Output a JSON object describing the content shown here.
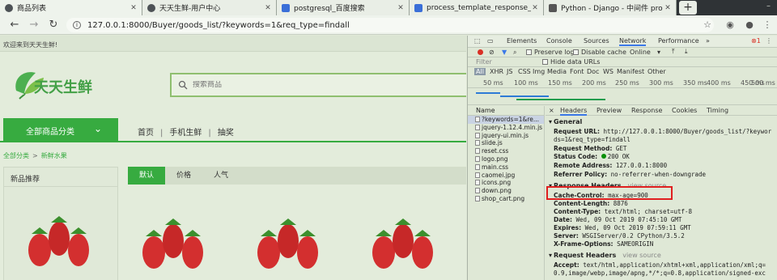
{
  "browser": {
    "tabs": [
      {
        "title": "商品列表",
        "active": true
      },
      {
        "title": "天天生鲜-用户中心",
        "active": false
      },
      {
        "title": "postgresql_百度搜索",
        "active": false
      },
      {
        "title": "process_template_response_",
        "active": false
      },
      {
        "title": "Python - Django - 中间件 pro",
        "active": false
      }
    ],
    "new_tab": "+",
    "address": "127.0.0.1:8000/Buyer/goods_list/?keywords=1&req_type=findall",
    "info_icon": "i"
  },
  "site": {
    "welcome": "欢迎来到天天生鲜!",
    "logo_text": "天天生鲜",
    "search_placeholder": "搜索商品",
    "all_categories": "全部商品分类",
    "nav": [
      "首页",
      "手机生鲜",
      "抽奖"
    ],
    "breadcrumb": [
      "全部分类",
      "新鲜水果"
    ],
    "new_products": "新品推荐",
    "sort": [
      "默认",
      "价格",
      "人气"
    ],
    "accent_color": "#37ab40"
  },
  "devtools": {
    "tabs": [
      "Elements",
      "Console",
      "Sources",
      "Network",
      "Performance",
      "»"
    ],
    "error_count": "1",
    "toolbar": {
      "preserve_log": "Preserve log",
      "disable_cache": "Disable cache",
      "online": "Online"
    },
    "filter_placeholder": "Filter",
    "hide_data_urls": "Hide data URLs",
    "type_filters": [
      "All",
      "XHR",
      "JS",
      "CSS",
      "Img",
      "Media",
      "Font",
      "Doc",
      "WS",
      "Manifest",
      "Other"
    ],
    "ticks": [
      "50 ms",
      "100 ms",
      "150 ms",
      "200 ms",
      "250 ms",
      "300 ms",
      "350 ms",
      "400 ms",
      "450 ms",
      "500 ms"
    ],
    "name_header": "Name",
    "requests": [
      "?keywords=1&re...",
      "jquery-1.12.4.min.js",
      "jquery-ui.min.js",
      "slide.js",
      "reset.css",
      "logo.png",
      "main.css",
      "caomei.jpg",
      "icons.png",
      "down.png",
      "shop_cart.png"
    ],
    "detail_tabs": [
      "×",
      "Headers",
      "Preview",
      "Response",
      "Cookies",
      "Timing"
    ],
    "general_title": "General",
    "general": [
      {
        "k": "Request URL:",
        "v": "http://127.0.0.1:8000/Buyer/goods_list/?keywor"
      },
      {
        "k": "",
        "v": "ds=1&req_type=findall"
      },
      {
        "k": "Request Method:",
        "v": "GET"
      },
      {
        "k": "Status Code:",
        "v": "200 OK"
      },
      {
        "k": "Remote Address:",
        "v": "127.0.0.1:8000"
      },
      {
        "k": "Referrer Policy:",
        "v": "no-referrer-when-downgrade"
      }
    ],
    "response_title": "Response Headers",
    "view_source": "view source",
    "response": [
      {
        "k": "Cache-Control:",
        "v": "max-age=900"
      },
      {
        "k": "Content-Length:",
        "v": "8876"
      },
      {
        "k": "Content-Type:",
        "v": "text/html; charset=utf-8"
      },
      {
        "k": "Date:",
        "v": "Wed, 09 Oct 2019 07:45:10 GMT"
      },
      {
        "k": "Expires:",
        "v": "Wed, 09 Oct 2019 07:59:11 GMT"
      },
      {
        "k": "Server:",
        "v": "WSGIServer/0.2 CPython/3.5.2"
      },
      {
        "k": "X-Frame-Options:",
        "v": "SAMEORIGIN"
      }
    ],
    "request_title": "Request Headers",
    "request": [
      {
        "k": "Accept:",
        "v": "text/html,application/xhtml+xml,application/xml;q="
      },
      {
        "k": "",
        "v": "0.9,image/webp,image/apng,*/*;q=0.8,application/signed-exc"
      }
    ]
  }
}
